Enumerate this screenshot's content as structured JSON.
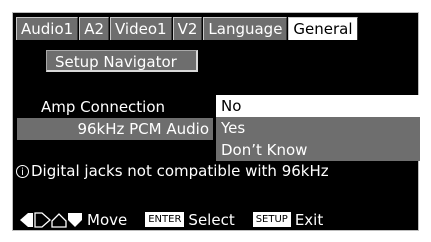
{
  "tabs": [
    {
      "label": "Audio1",
      "active": false
    },
    {
      "label": "A2",
      "active": false
    },
    {
      "label": "Video1",
      "active": false
    },
    {
      "label": "V2",
      "active": false
    },
    {
      "label": "Language",
      "active": false
    },
    {
      "label": "General",
      "active": true
    }
  ],
  "setup_navigator": {
    "label": "Setup Navigator"
  },
  "amp_connection": {
    "label": "Amp Connection",
    "options": [
      "No",
      "Yes",
      "Don’t Know"
    ],
    "selected": "No"
  },
  "pcm_audio": {
    "label": "96kHz PCM Audio"
  },
  "info": {
    "icon": "info-icon",
    "text": "Digital jacks not compatible with 96kHz"
  },
  "footer": {
    "arrow_icons": [
      "left-arrow-icon",
      "right-arrow-icon",
      "up-arrow-icon",
      "down-arrow-icon"
    ],
    "move_label": "Move",
    "enter_key": "ENTER",
    "select_label": "Select",
    "setup_key": "SETUP",
    "exit_label": "Exit"
  },
  "colors": {
    "background": "#000000",
    "panel_gray": "#6e6e6e",
    "highlight": "#ffffff"
  }
}
